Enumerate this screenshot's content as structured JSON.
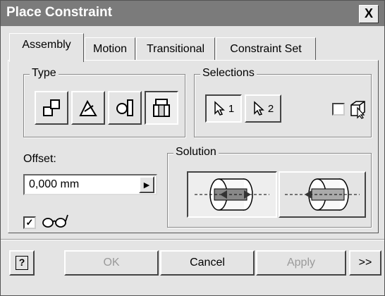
{
  "window": {
    "title": "Place Constraint",
    "close_glyph": "X"
  },
  "tabs": [
    {
      "label": "Assembly",
      "active": true
    },
    {
      "label": "Motion",
      "active": false
    },
    {
      "label": "Transitional",
      "active": false
    },
    {
      "label": "Constraint Set",
      "active": false
    }
  ],
  "type_group": {
    "label": "Type",
    "buttons": [
      {
        "icon": "mate-icon",
        "pressed": false
      },
      {
        "icon": "angle-icon",
        "pressed": false
      },
      {
        "icon": "tangent-icon",
        "pressed": false
      },
      {
        "icon": "insert-icon",
        "pressed": true
      }
    ]
  },
  "selections_group": {
    "label": "Selections",
    "first_selection": "1",
    "second_selection": "2",
    "pick_part_first_checked": false,
    "pick_part_icon": "pick-part-first-icon"
  },
  "offset": {
    "label": "Offset:",
    "value": "0,000 mm",
    "arrow_glyph": "▶"
  },
  "solution_group": {
    "label": "Solution",
    "options": [
      {
        "icon": "opposed-solution-icon",
        "selected": true
      },
      {
        "icon": "aligned-solution-icon",
        "selected": false
      }
    ]
  },
  "preview": {
    "checked": true,
    "check_glyph": "✓",
    "icon": "glasses-icon"
  },
  "footer": {
    "help_glyph": "?",
    "ok_label": "OK",
    "cancel_label": "Cancel",
    "apply_label": "Apply",
    "more_label": ">>",
    "ok_enabled": false,
    "apply_enabled": false
  }
}
